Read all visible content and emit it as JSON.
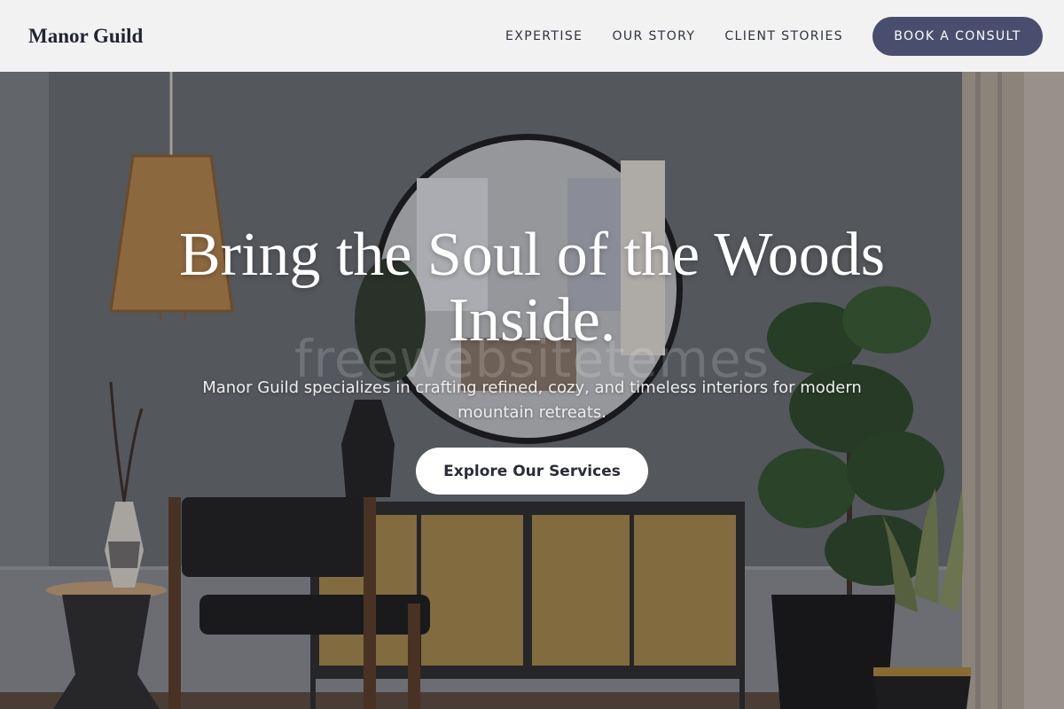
{
  "header": {
    "brand": "Manor Guild",
    "nav": [
      {
        "label": "EXPERTISE"
      },
      {
        "label": "OUR STORY"
      },
      {
        "label": "CLIENT STORIES"
      }
    ],
    "cta_label": "BOOK A CONSULT"
  },
  "hero": {
    "title": "Bring the Soul of the Woods Inside.",
    "subtitle": "Manor Guild specializes in crafting refined, cozy, and timeless interiors for modern mountain retreats.",
    "button_label": "Explore Our Services",
    "watermark": "freewebsitetemes"
  },
  "colors": {
    "header_bg": "#f2f2f2",
    "cta_bg": "#4a4e6e",
    "wall": "#6e7275"
  }
}
